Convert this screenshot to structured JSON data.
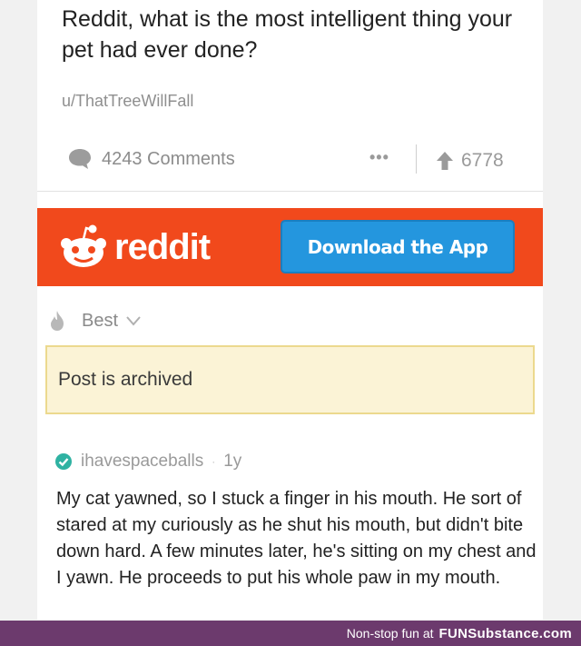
{
  "post": {
    "title": "Reddit, what is the most intelligent thing your pet had ever done?",
    "author": "u/ThatTreeWillFall",
    "comments_count": "4243 Comments",
    "more": "•••",
    "score": "6778"
  },
  "banner": {
    "logo_text": "reddit",
    "download_label": "Download the App",
    "color": "#f1491c",
    "button_color": "#2496de"
  },
  "sort": {
    "label": "Best"
  },
  "notice": {
    "text": "Post is archived"
  },
  "comment": {
    "username": "ihavespaceballs",
    "separator": "·",
    "age": "1y",
    "body": "My cat yawned, so I stuck a finger in his mouth. He sort of stared at my curiously as he shut his mouth, but didn't bite down hard. A few minutes later, he's sitting on my chest and I yawn. He proceeds to put his whole paw in my mouth."
  },
  "watermark": {
    "text": "Non-stop fun at",
    "brand": "FUNSubstance.com",
    "color": "#6c3a6d"
  },
  "icons": {
    "comments": "speech-bubble-icon",
    "upvote": "up-arrow-icon",
    "sort": "flame-icon",
    "dropdown": "chevron-down-icon",
    "verified": "check-circle-icon",
    "logo": "snoo-icon"
  }
}
